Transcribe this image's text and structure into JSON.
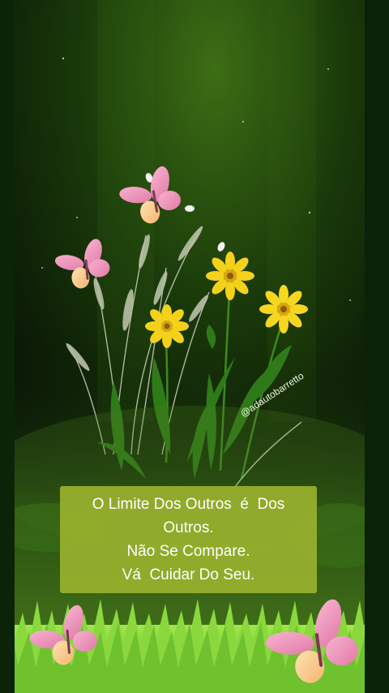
{
  "watermark": {
    "handle": "@adautobarretto"
  },
  "caption": {
    "lines": [
      "O Limite Dos Outros  é  Dos",
      "Outros.",
      "Não Se Compare.",
      "Vá  Cuidar Do Seu."
    ]
  },
  "colors": {
    "background": "#0a1a08",
    "glow": "#2f5a14",
    "caption_box": "#98b02d",
    "caption_text": "#ffffff",
    "flower_yellow": "#f4d21c",
    "butterfly_pink": "#f5a9c8",
    "grass": "#7fd435"
  },
  "icons": [
    "butterfly-icon",
    "sunflower-icon",
    "grass-icon"
  ]
}
